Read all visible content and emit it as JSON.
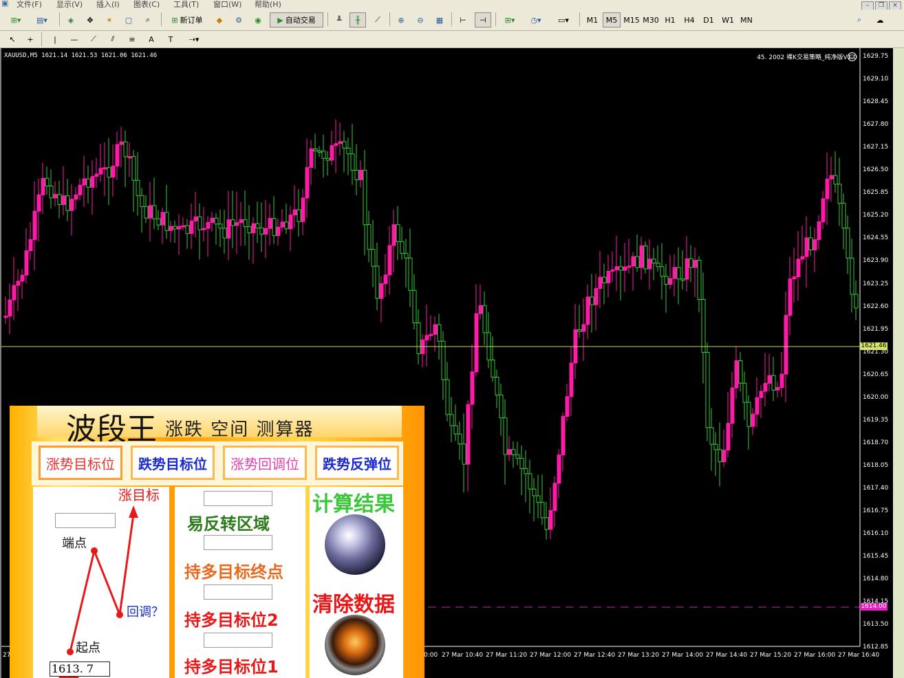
{
  "menu": {
    "items": [
      "文件(F)",
      "显示(V)",
      "插入(I)",
      "图表(C)",
      "工具(T)",
      "窗口(W)",
      "帮助(H)"
    ]
  },
  "toolbar": {
    "new_order_label": "新订单",
    "auto_trade_label": "自动交易",
    "timeframes": [
      "M1",
      "M5",
      "M15",
      "M30",
      "H1",
      "H4",
      "D1",
      "W1",
      "MN"
    ],
    "active_timeframe": "M5"
  },
  "chart": {
    "header": "XAUUSD,M5  1621.14 1621.53 1621.06 1621.46",
    "ea_label": "45. 2002 裸K交易策略_纯净版V1.0",
    "current_price": "1621.46",
    "level_price": "1614.00",
    "bull_color": "#ff1aa8",
    "bear_color": "#33cc33",
    "price_axis": [
      "1629.75",
      "1629.10",
      "1628.45",
      "1627.80",
      "1627.15",
      "1626.50",
      "1625.85",
      "1625.20",
      "1624.55",
      "1623.90",
      "1623.25",
      "1622.60",
      "1621.95",
      "1621.30",
      "1620.65",
      "1620.00",
      "1619.35",
      "1618.70",
      "1618.05",
      "1617.40",
      "1616.75",
      "1616.10",
      "1615.45",
      "1614.80",
      "1614.15",
      "1613.50",
      "1612.85"
    ],
    "time_axis": [
      "27",
      "0:00",
      "27 Mar 10:40",
      "27 Mar 11:20",
      "27 Mar 12:00",
      "27 Mar 12:40",
      "27 Mar 13:20",
      "27 Mar 14:00",
      "27 Mar 14:40",
      "27 Mar 15:20",
      "27 Mar 16:00",
      "27 Mar 16:40"
    ]
  },
  "panel": {
    "title_main": "波段王",
    "title_sub": "涨跌 空间 测算器",
    "tabs": [
      {
        "label": "涨势目标位",
        "color": "#e83030"
      },
      {
        "label": "跌势目标位",
        "color": "#1a2ad0"
      },
      {
        "label": "涨势回调位",
        "color": "#e040b0"
      },
      {
        "label": "跌势反弹位",
        "color": "#1a2ad0"
      }
    ],
    "diagram": {
      "target_label": "涨目标",
      "end_label": "端点",
      "pullback_label": "回调？",
      "start_label": "起点",
      "start_value": "1613. 7"
    },
    "results": {
      "reversal_zone": "易反转区域",
      "long_target_end": "持多目标终点",
      "long_target_2": "持多目标位2",
      "long_target_1": "持多目标位1"
    },
    "actions": {
      "calculate": "计算结果",
      "clear": "清除数据"
    }
  }
}
